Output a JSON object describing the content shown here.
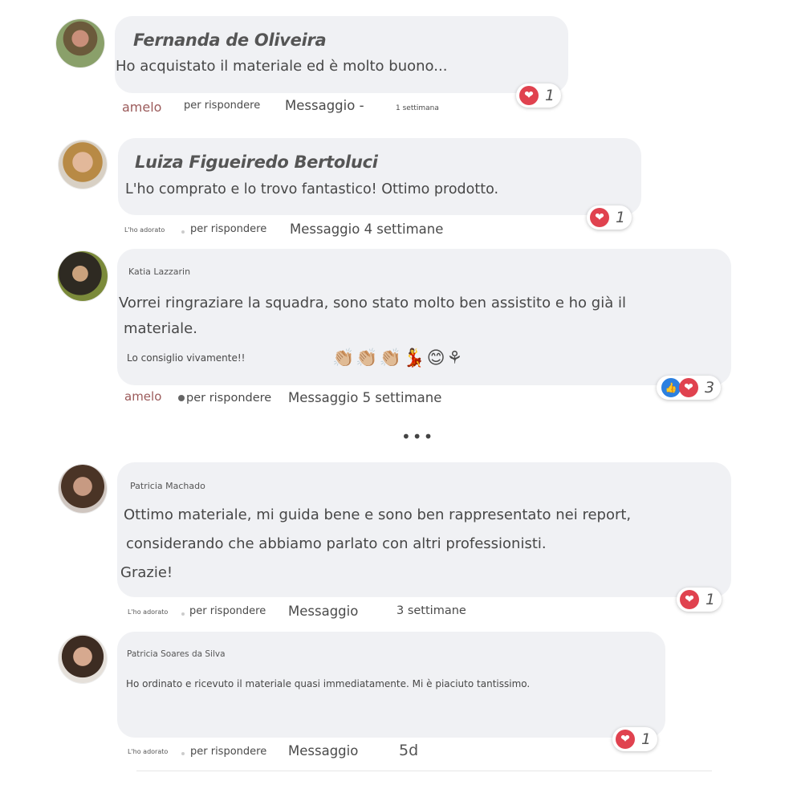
{
  "comments": [
    {
      "author": "Fernanda de Oliveira",
      "text": "Ho acquistato il materiale ed è molto buono...",
      "like_label": "amelo",
      "reply_label": "per rispondere",
      "message_label": "Messaggio -",
      "time": "1 settimana",
      "reaction_count": "1"
    },
    {
      "author": "Luiza Figueiredo Bertoluci",
      "text": "L'ho comprato e lo trovo fantastico! Ottimo prodotto.",
      "like_label": "L'ho adorato",
      "reply_label": "per rispondere",
      "message_label": "Messaggio 4 settimane",
      "reaction_count": "1"
    },
    {
      "author": "Katia Lazzarin",
      "text_line1": "Vorrei ringraziare la squadra, sono stato molto ben assistito e ho già il",
      "text_line2": "materiale.",
      "text_line3": "Lo consiglio vivamente!!",
      "emojis": "👏🏼👏🏼👏🏼💃😊⚘",
      "like_label": "amelo",
      "reply_label": "per rispondere",
      "message_label": "Messaggio 5 settimane",
      "reaction_count": "3"
    },
    {
      "author": "Patricia Machado",
      "text_line1": "Ottimo materiale, mi guida bene e sono ben rappresentato nei report,",
      "text_line2": "considerando che abbiamo parlato con altri professionisti.",
      "text_line3": "Grazie!",
      "like_label": "L'ho adorato",
      "reply_label": "per rispondere",
      "message_label": "Messaggio",
      "time": "3 settimane",
      "reaction_count": "1"
    },
    {
      "author": "Patricia Soares da Silva",
      "text": "Ho ordinato e ricevuto il materiale quasi immediatamente. Mi è piaciuto tantissimo.",
      "like_label": "L'ho adorato",
      "reply_label": "per rispondere",
      "message_label": "Messaggio",
      "time": "5d",
      "reaction_count": "1"
    }
  ],
  "more_indicator": "•••",
  "icons": {
    "love": "heart-icon",
    "like": "thumbs-up-icon",
    "more": "more-dots-icon"
  },
  "colors": {
    "bubble": "#f0f1f4",
    "love": "#e0424f",
    "like": "#2c80e0",
    "like_label": "#9b5a5a"
  }
}
